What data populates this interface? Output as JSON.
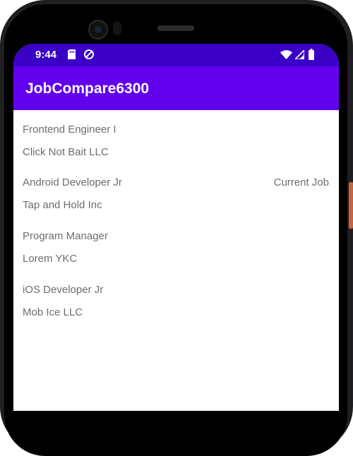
{
  "status_bar": {
    "time": "9:44",
    "left_icons": [
      "sd-card-icon",
      "data-saver-icon"
    ],
    "right_icons": [
      "wifi-icon",
      "signal-icon",
      "battery-icon"
    ]
  },
  "app_bar": {
    "title": "JobCompare6300",
    "color": "#6200ee",
    "status_color": "#3a00c5"
  },
  "jobs": [
    {
      "title": "Frontend Engineer I",
      "company": "Click Not Bait LLC",
      "badge": ""
    },
    {
      "title": "Android Developer Jr",
      "company": "Tap and Hold Inc",
      "badge": "Current Job"
    },
    {
      "title": "Program Manager",
      "company": "Lorem YKC",
      "badge": ""
    },
    {
      "title": "iOS Developer Jr",
      "company": "Mob Ice LLC",
      "badge": ""
    }
  ]
}
